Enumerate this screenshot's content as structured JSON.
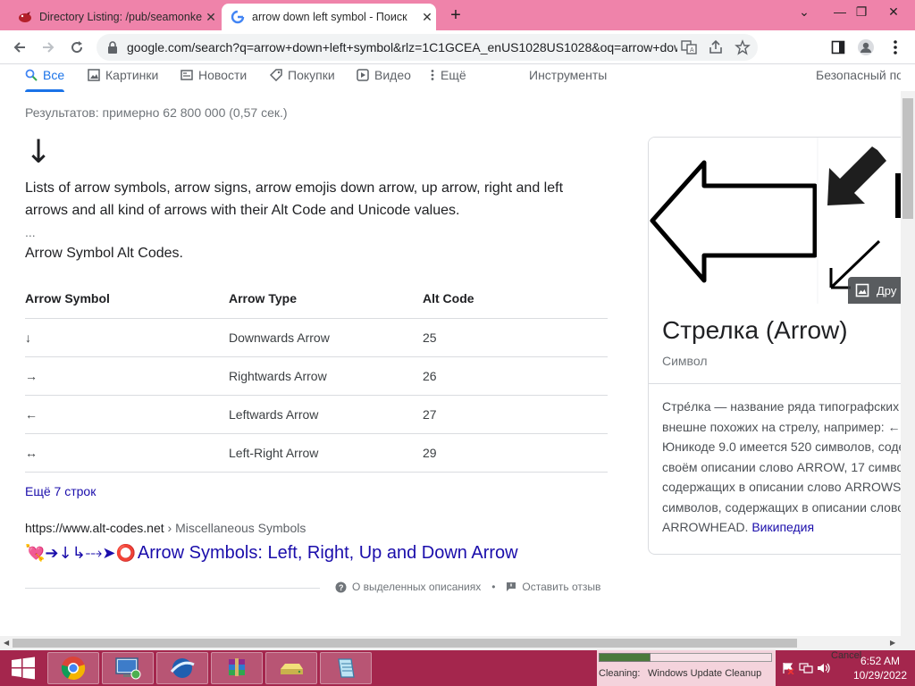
{
  "browser": {
    "tabs": [
      {
        "title": "Directory Listing: /pub/seamonke",
        "active": false
      },
      {
        "title": "arrow down left symbol - Поиск",
        "active": true
      }
    ],
    "url": "google.com/search?q=arrow+down+left+symbol&rlz=1C1GCEA_enUS1028US1028&oq=arrow+down+left..."
  },
  "search_tabs": {
    "all": "Все",
    "images": "Картинки",
    "news": "Новости",
    "shopping": "Покупки",
    "video": "Видео",
    "more": "Ещё",
    "tools": "Инструменты",
    "safe_search": "Безопасный по"
  },
  "results_count": "Результатов: примерно 62 800 000 (0,57 сек.)",
  "featured": {
    "symbol": "↓",
    "snippet": "Lists of arrow symbols, arrow signs, arrow emojis down arrow, up arrow, right and left arrows and all kind of arrows with their Alt Code and Unicode values.",
    "ellipsis": "...",
    "subheading": "Arrow Symbol Alt Codes.",
    "table": {
      "headers": [
        "Arrow Symbol",
        "Arrow Type",
        "Alt Code"
      ],
      "rows": [
        [
          "↓",
          "Downwards Arrow",
          "25"
        ],
        [
          "→",
          "Rightwards Arrow",
          "26"
        ],
        [
          "←",
          "Leftwards Arrow",
          "27"
        ],
        [
          "↔",
          "Left-Right Arrow",
          "29"
        ]
      ]
    },
    "more_rows": "Ещё 7 строк"
  },
  "result": {
    "cite_domain": "https://www.alt-codes.net",
    "cite_path": " › Miscellaneous Symbols",
    "title_emoji": "💘➔↓↳⤏➤⭕",
    "title": " Arrow Symbols: Left, Right, Up and Down Arrow"
  },
  "footer": {
    "about": "О выделенных описаниях",
    "feedback": "Оставить отзыв",
    "sep": "•"
  },
  "knowledge_panel": {
    "more_images": "Дру",
    "title": "Стрелка (Arrow)",
    "subtitle": "Символ",
    "desc_lines": [
      "Стре́лка — название ряда типографских",
      "внешне похожих на стрелу, например: ←",
      "Юникоде 9.0 имеется 520 символов, соде",
      "своём описании слово ARROW, 17 симво",
      "содержащих в описании слово ARROWS",
      "символов, содержащих в описании слово"
    ],
    "desc_last": "ARROWHEAD. ",
    "source": "Википедия"
  },
  "taskbar": {
    "cleaning_label": "Cleaning:",
    "cleaning_task": "Windows Update Cleanup",
    "cancel": "Cancel",
    "cleaning_progress": 0.3,
    "time": "6:52 AM",
    "date": "10/29/2022"
  },
  "colors": {
    "tabstrip": "#ef83aa",
    "taskbar": "#a4264d",
    "link": "#1a0dab",
    "accent": "#1a73e8"
  }
}
